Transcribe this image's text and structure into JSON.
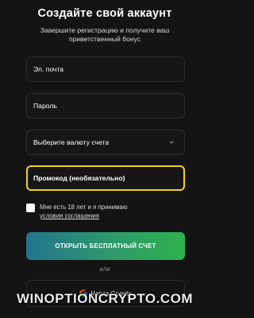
{
  "header": {
    "title": "Создайте свой аккаунт",
    "subtitle": "Завершите регистрацию и получите ваш приветственный бонус"
  },
  "form": {
    "email_placeholder": "Эл. почта",
    "password_placeholder": "Пароль",
    "currency_label": "Выберите валюту счета",
    "promo_placeholder": "Промокод (необязательно)"
  },
  "agreement": {
    "text": "Мне есть 18 лет и я принимаю",
    "link": "условия соглашения"
  },
  "buttons": {
    "open_account": "ОТКРЫТЬ БЕСПЛАТНЫЙ СЧЕТ",
    "or_divider": "или",
    "google": "Через Google"
  },
  "icons": {
    "select_chevron": "chevron-down-icon",
    "google": "google-icon"
  },
  "colors": {
    "background": "#141414",
    "promo_highlight": "#f3d21b",
    "cta_gradient_start": "#23748f",
    "cta_gradient_end": "#2fb14e"
  },
  "watermark": "WINOPTIONCRYPTO.COM"
}
